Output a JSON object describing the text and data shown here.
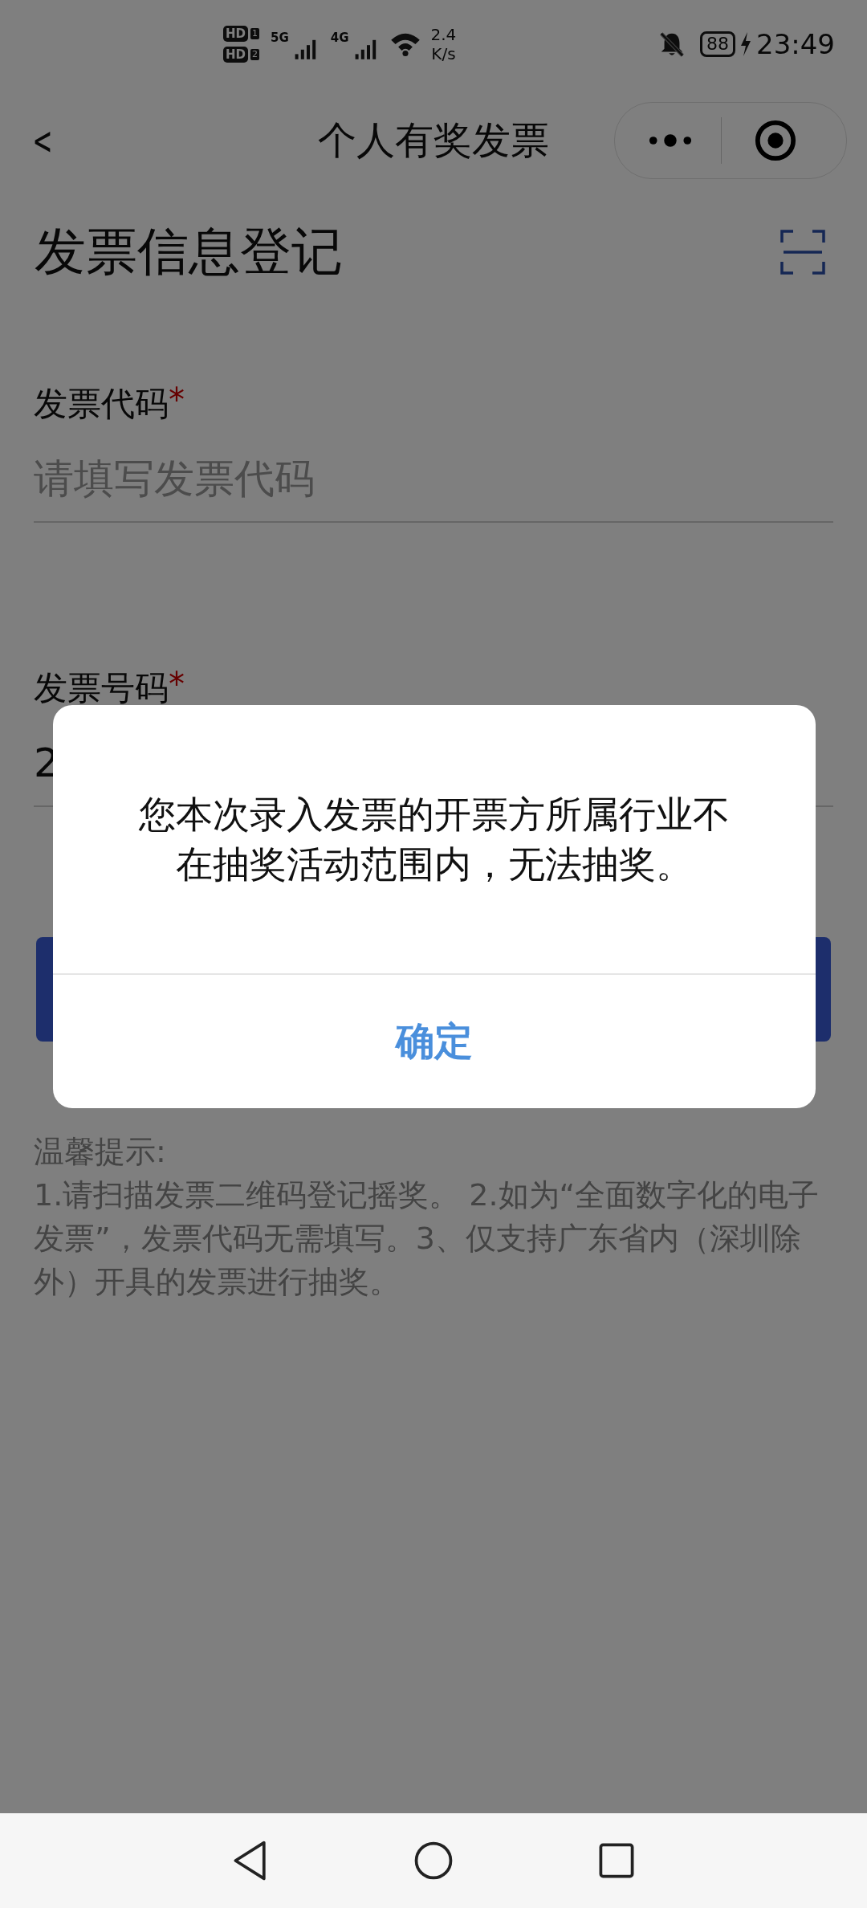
{
  "status_bar": {
    "sim_badges": [
      {
        "label": "HD",
        "slot": "1"
      },
      {
        "label": "HD",
        "slot": "2"
      }
    ],
    "networks": [
      "5G",
      "4G"
    ],
    "speed_value": "2.4",
    "speed_unit": "K/s",
    "battery": "88",
    "time": "23:49"
  },
  "nav": {
    "back": "<",
    "title": "个人有奖发票"
  },
  "page_title": "发票信息登记",
  "fields": [
    {
      "label": "发票代码",
      "required_mark": "*",
      "placeholder": "请填写发票代码"
    },
    {
      "label": "发票号码",
      "required_mark": "*",
      "value": "2"
    }
  ],
  "tips": {
    "title": "温馨提示:",
    "body": "1.请扫描发票二维码登记摇奖。 2.如为“全面数字化的电子发票”，发票代码无需填写。3、仅支持广东省内（深圳除外）开具的发票进行抽奖。"
  },
  "dialog": {
    "message": "您本次录入发票的开票方所属行业不在抽奖活动范围内，无法抽奖。",
    "confirm": "确定"
  }
}
